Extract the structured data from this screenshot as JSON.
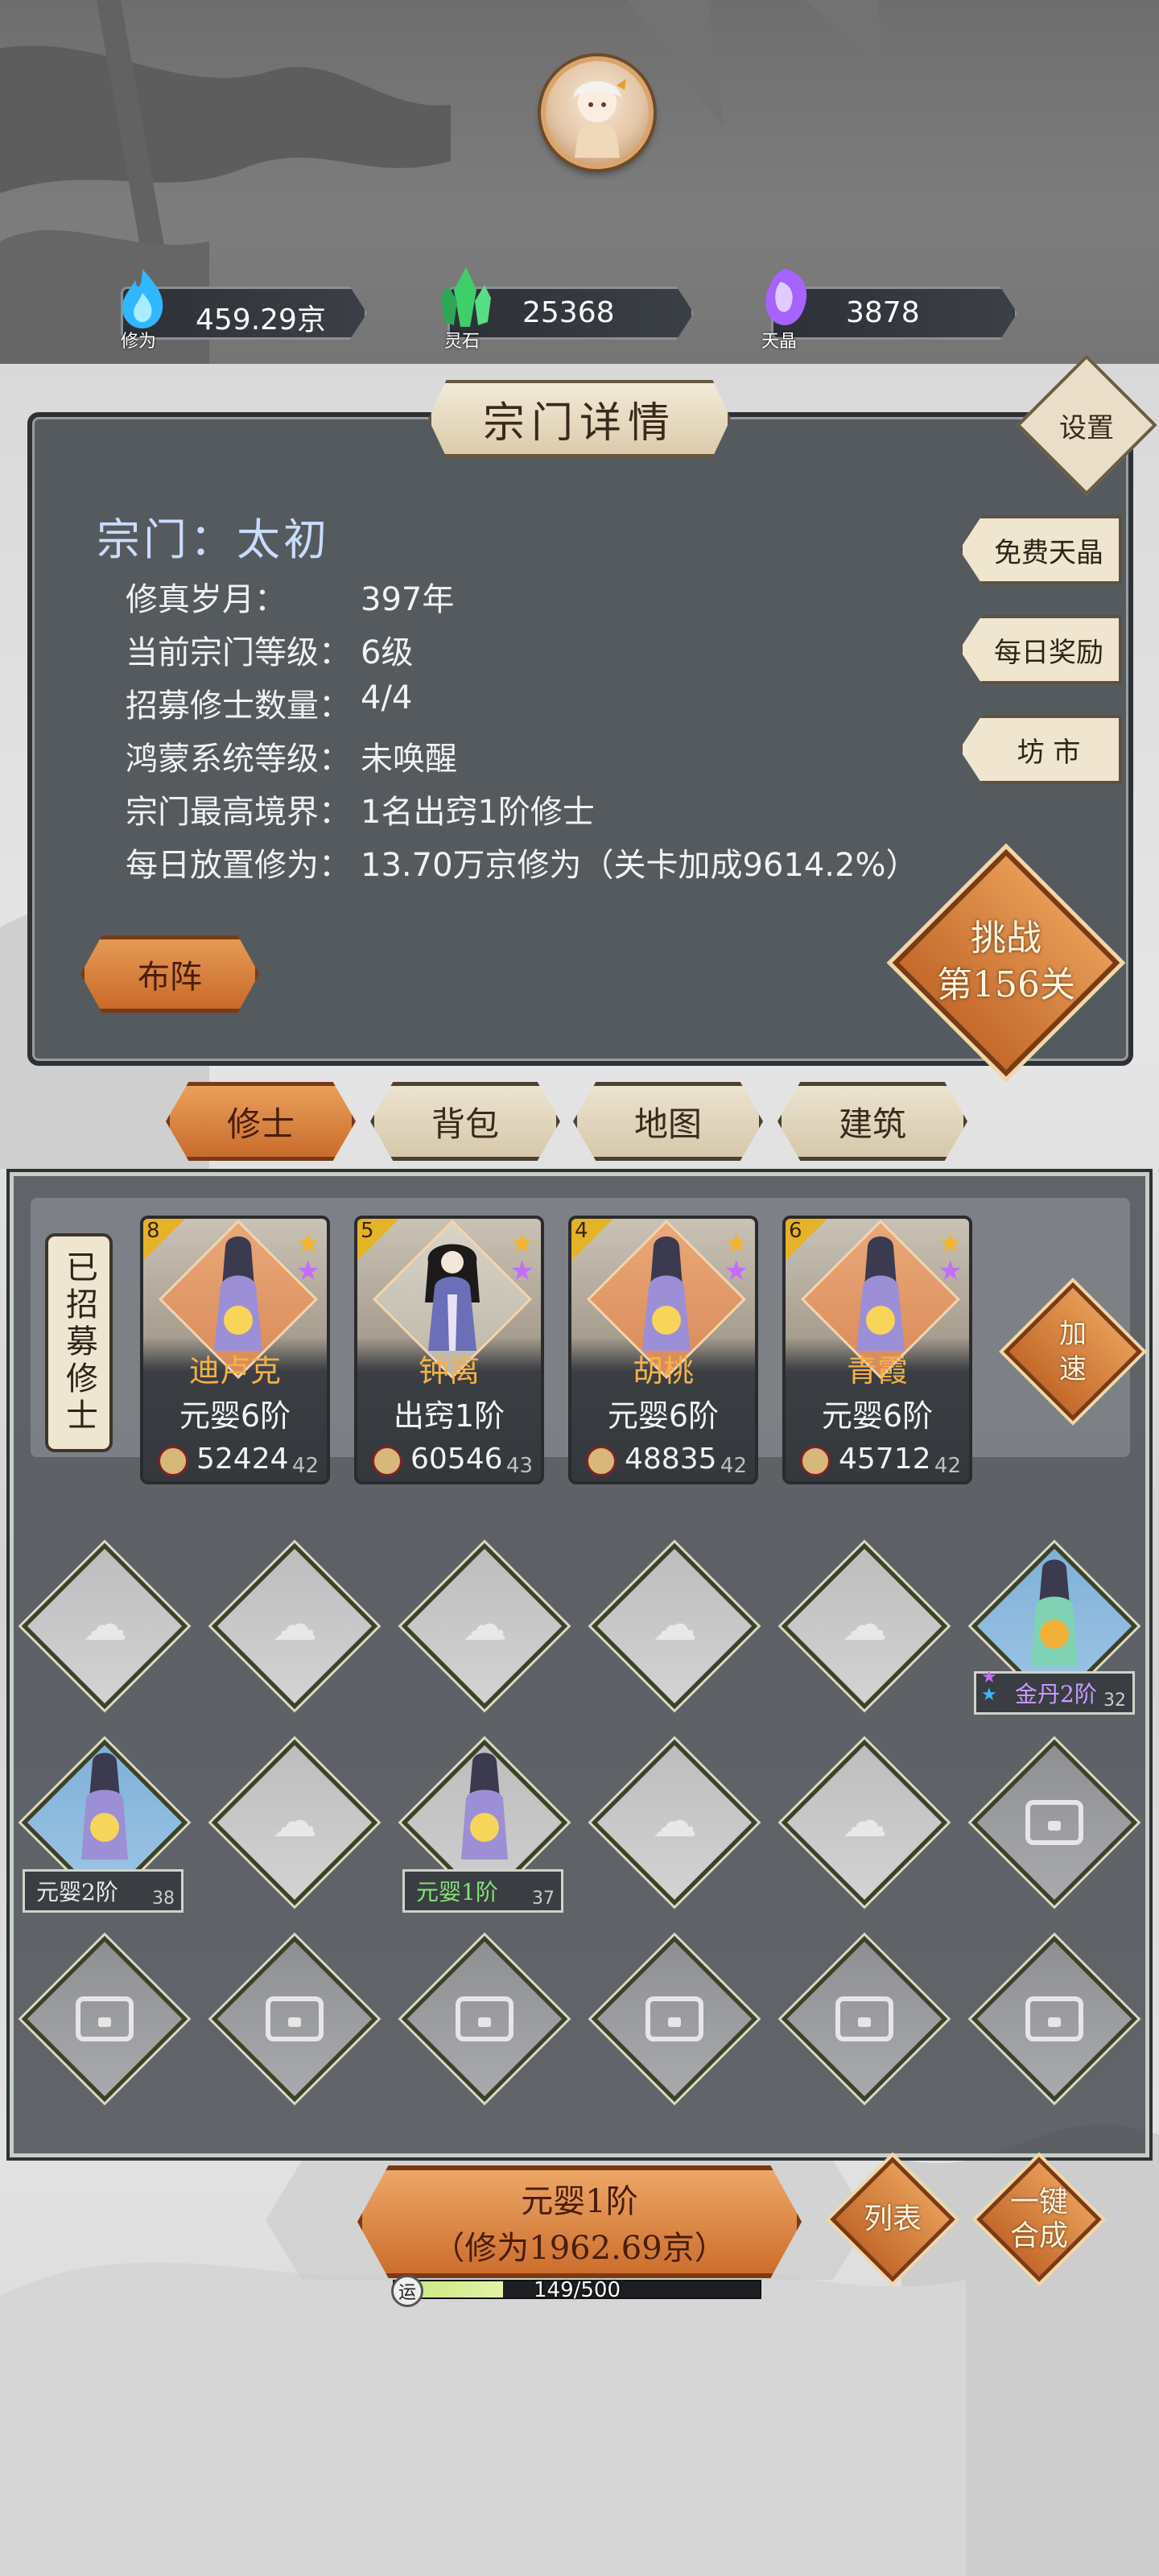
{
  "resources": [
    {
      "name": "修为",
      "value": "459.29京",
      "icon": "blue-flame-icon",
      "color": "#38c7ff"
    },
    {
      "name": "灵石",
      "value": "25368",
      "icon": "green-crystal-icon",
      "color": "#4bd67a"
    },
    {
      "name": "天晶",
      "value": "3878",
      "icon": "purple-crystal-icon",
      "color": "#b46cff"
    }
  ],
  "panel": {
    "title": "宗门详情",
    "settings_label": "设置",
    "sect_name": "宗门：太初",
    "info": [
      {
        "label": "修真岁月：",
        "value": "397年"
      },
      {
        "label": "当前宗门等级：",
        "value": "6级"
      },
      {
        "label": "招募修士数量：",
        "value": "4/4"
      },
      {
        "label": "鸿蒙系统等级：",
        "value": "未唤醒"
      },
      {
        "label": "宗门最高境界：",
        "value": "1名出窍1阶修士"
      },
      {
        "label": "每日放置修为：",
        "value": "13.70万京修为（关卡加成9614.2%）"
      }
    ],
    "side_buttons": [
      "免费天晶",
      "每日奖励",
      "坊 市"
    ],
    "formation_label": "布阵",
    "challenge_line1": "挑战",
    "challenge_line2": "第156关"
  },
  "tabs": [
    "修士",
    "背包",
    "地图",
    "建筑"
  ],
  "recruit": {
    "label": "已招募修士",
    "speedup_line1": "加",
    "speedup_line2": "速",
    "cards": [
      {
        "level": "8",
        "name": "迪卢克",
        "rank": "元婴6阶",
        "power": "52424",
        "lv": "42"
      },
      {
        "level": "5",
        "name": "钟离",
        "rank": "出窍1阶",
        "power": "60546",
        "lv": "43"
      },
      {
        "level": "4",
        "name": "胡桃",
        "rank": "元婴6阶",
        "power": "48835",
        "lv": "42"
      },
      {
        "level": "6",
        "name": "青霞",
        "rank": "元婴6阶",
        "power": "45712",
        "lv": "42"
      }
    ]
  },
  "grid_units": [
    {
      "rank": "金丹2阶",
      "lv": "32",
      "color": "#c79bff"
    },
    {
      "rank": "元婴2阶",
      "lv": "38",
      "color": "#e9e9e9"
    },
    {
      "rank": "元婴1阶",
      "lv": "37",
      "color": "#86e07a"
    }
  ],
  "bottom": {
    "merge_line1": "元婴1阶",
    "merge_line2": "（修为1962.69京）",
    "list_label_1": "列",
    "list_label_2": "表",
    "auto_merge_1": "一键",
    "auto_merge_2": "合成",
    "luck_icon_char": "运",
    "luck_text": "149/500",
    "luck_fraction": 0.298
  },
  "colors": {
    "accent_orange": "#d9823f",
    "panel_bg": "#555a5e",
    "gold_text": "#f2b24a"
  }
}
